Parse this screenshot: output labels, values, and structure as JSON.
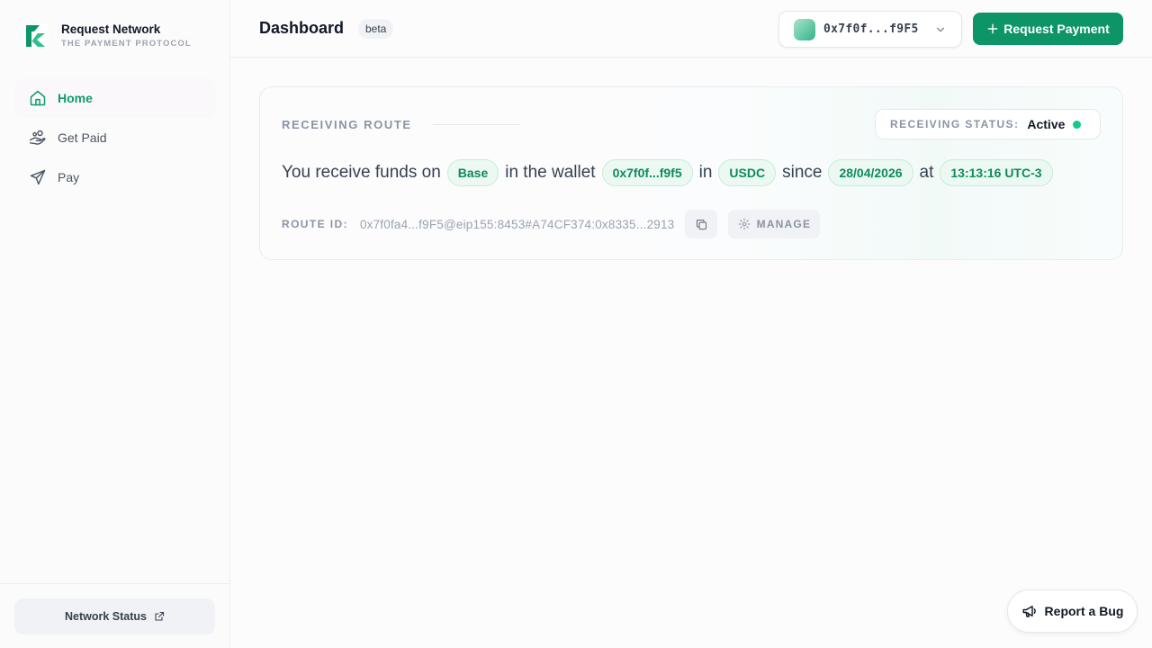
{
  "brand": {
    "name": "Request Network",
    "tagline": "THE PAYMENT PROTOCOL",
    "logo_icon": "request-network-logo",
    "accent_color": "#0d9467"
  },
  "sidebar": {
    "items": [
      {
        "label": "Home",
        "icon": "home-icon",
        "active": true
      },
      {
        "label": "Get Paid",
        "icon": "hand-coins-icon",
        "active": false
      },
      {
        "label": "Pay",
        "icon": "send-icon",
        "active": false
      }
    ],
    "footer": {
      "label": "Network Status",
      "icon": "external-link-icon"
    }
  },
  "header": {
    "title": "Dashboard",
    "badge": "beta",
    "wallet": {
      "address": "0x7f0f...f9F5",
      "icon": "chevron-down-icon"
    },
    "primary_action": {
      "label": "Request Payment",
      "icon": "plus-icon"
    }
  },
  "route_card": {
    "section_label": "RECEIVING ROUTE",
    "status_label": "RECEIVING STATUS:",
    "status_value": "Active",
    "status_color": "#11c98a",
    "sentence": {
      "t1": "You receive funds on",
      "network": "Base",
      "t2": "in the wallet",
      "wallet": "0x7f0f...f9f5",
      "t3": "in",
      "currency": "USDC",
      "t4": "since",
      "date": "28/04/2026",
      "t5": "at",
      "time": "13:13:16 UTC-3"
    },
    "route_id_label": "ROUTE ID:",
    "route_id_value": "0x7f0fa4...f9F5@eip155:8453#A74CF374:0x8335...2913",
    "copy_icon": "copy-icon",
    "manage_label": "MANAGE",
    "manage_icon": "gear-icon"
  },
  "report_bug": {
    "label": "Report a Bug",
    "icon": "megaphone-icon"
  }
}
